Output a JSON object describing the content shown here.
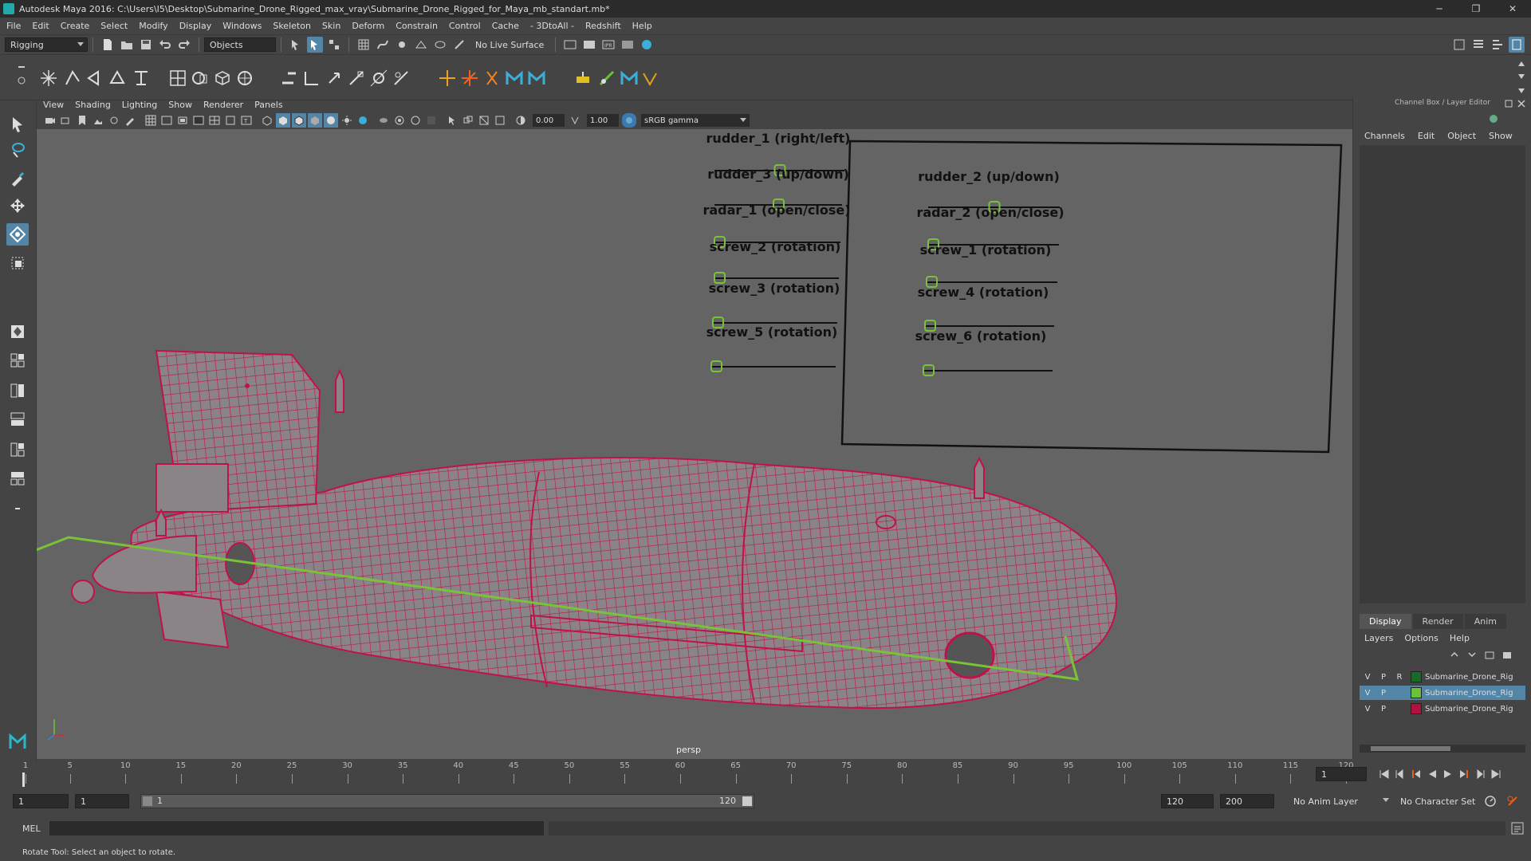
{
  "window": {
    "title": "Autodesk Maya 2016: C:\\Users\\I5\\Desktop\\Submarine_Drone_Rigged_max_vray\\Submarine_Drone_Rigged_for_Maya_mb_standart.mb*",
    "minimize": "─",
    "restore": "❐",
    "close": "✕"
  },
  "menubar": [
    "File",
    "Edit",
    "Create",
    "Select",
    "Modify",
    "Display",
    "Windows",
    "Skeleton",
    "Skin",
    "Deform",
    "Constrain",
    "Control",
    "Cache",
    "- 3DtoAll -",
    "Redshift",
    "Help"
  ],
  "statusline": {
    "menuset": "Rigging",
    "selection_mode": "Objects",
    "live_surface": "No Live Surface"
  },
  "panel": {
    "menu": [
      "View",
      "Shading",
      "Lighting",
      "Show",
      "Renderer",
      "Panels"
    ],
    "near_value": "0.00",
    "far_value": "1.00",
    "color_space": "sRGB gamma",
    "camera": "persp"
  },
  "controls": [
    {
      "label": "rudder_1 (right/left)",
      "slider": 0.5
    },
    {
      "label": "rudder_3 (up/down)",
      "slider": 0.5
    },
    {
      "label": "radar_1 (open/close)",
      "slider": 0.0
    },
    {
      "label": "screw_2 (rotation)",
      "slider": 0.0
    },
    {
      "label": "screw_3 (rotation)",
      "slider": 0.0
    },
    {
      "label": "screw_5 (rotation)",
      "slider": 0.0
    },
    {
      "label": "rudder_2 (up/down)",
      "slider": 0.5
    },
    {
      "label": "radar_2 (open/close)",
      "slider": 0.0
    },
    {
      "label": "screw_1 (rotation)",
      "slider": 0.0
    },
    {
      "label": "screw_4 (rotation)",
      "slider": 0.0
    },
    {
      "label": "screw_6 (rotation)",
      "slider": 0.0
    }
  ],
  "channelbox": {
    "title": "Channel Box / Layer Editor",
    "menu": [
      "Channels",
      "Edit",
      "Object",
      "Show"
    ],
    "layer_tabs": [
      "Display",
      "Render",
      "Anim"
    ],
    "layer_menu": [
      "Layers",
      "Options",
      "Help"
    ],
    "layers": [
      {
        "v": "V",
        "p": "P",
        "r": "R",
        "color": "#1a6b2a",
        "name": "Submarine_Drone_Rig",
        "selected": false
      },
      {
        "v": "V",
        "p": "P",
        "r": "",
        "color": "#6ac23a",
        "name": "Submarine_Drone_Rig",
        "selected": true
      },
      {
        "v": "V",
        "p": "P",
        "r": "",
        "color": "#b0123c",
        "name": "Submarine_Drone_Rig",
        "selected": false
      }
    ]
  },
  "timeline": {
    "ticks": [
      "1",
      "5",
      "10",
      "15",
      "20",
      "25",
      "30",
      "35",
      "40",
      "45",
      "50",
      "55",
      "60",
      "65",
      "70",
      "75",
      "80",
      "85",
      "90",
      "95",
      "100",
      "105",
      "110",
      "115",
      "120"
    ],
    "current_frame": "1"
  },
  "range": {
    "start": "1",
    "playback_start": "1",
    "slider_start": "1",
    "slider_end": "120",
    "playback_end": "120",
    "end": "200",
    "anim_layer": "No Anim Layer",
    "character_set": "No Character Set"
  },
  "cmdline": {
    "lang": "MEL"
  },
  "helpline": "Rotate Tool: Select an object to rotate.",
  "colors": {
    "wireframe": "#c0124a",
    "rig_line": "#7ac23a",
    "viewport": "#646464",
    "accent": "#5285a6"
  }
}
